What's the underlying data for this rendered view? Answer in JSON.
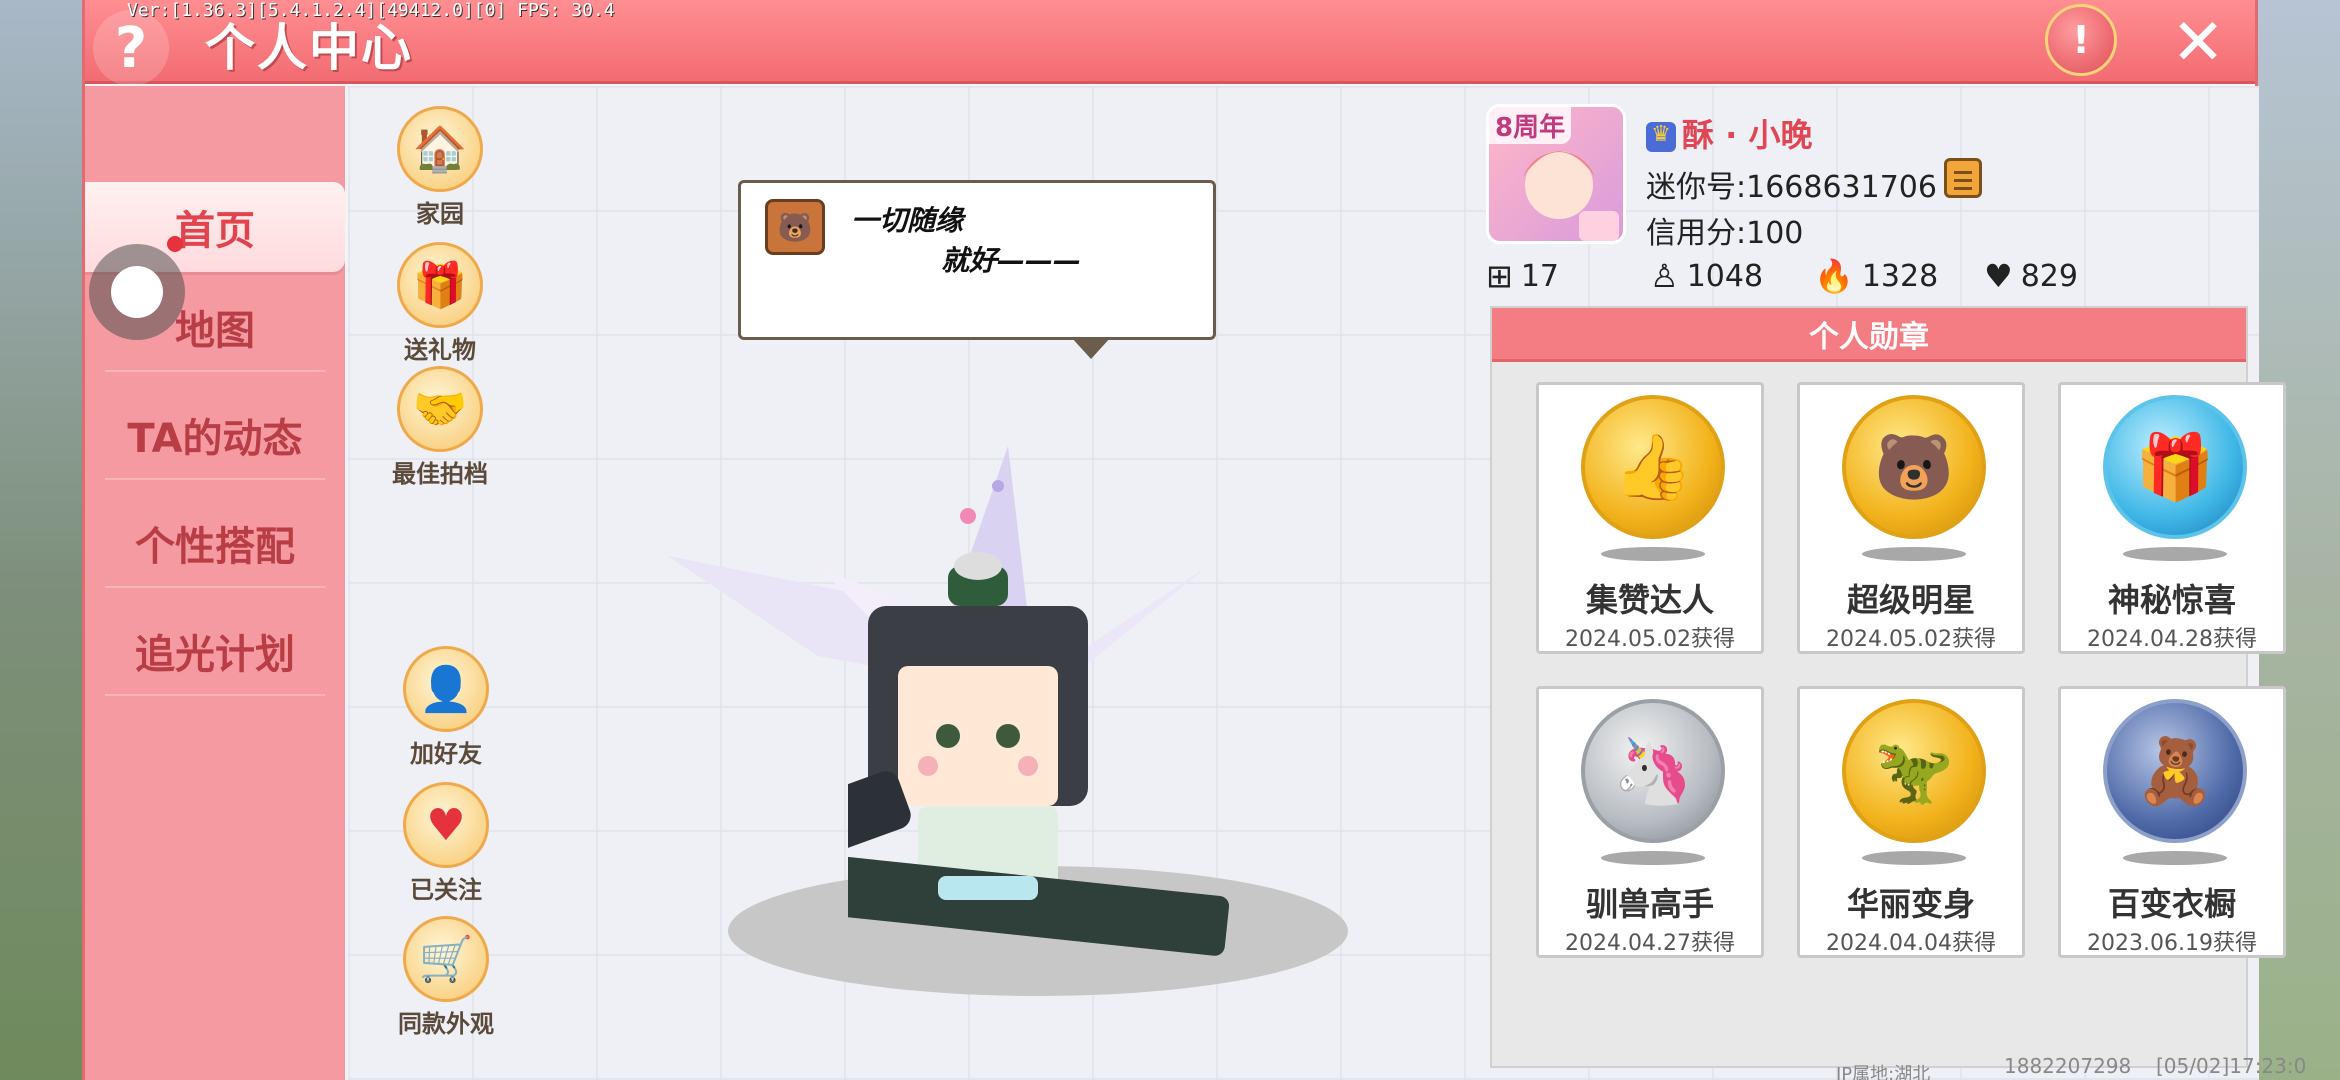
{
  "header": {
    "version": "Ver:[1.36.3][5.4.1.2.4][49412.0][0] FPS: 30.4",
    "title": "个人中心",
    "help_icon": "question-icon",
    "report_icon": "warning-icon",
    "close_icon": "close-icon"
  },
  "sidebar": {
    "items": [
      {
        "label": "首页",
        "active": true
      },
      {
        "label": "地图",
        "active": false
      },
      {
        "label": "TA的动态",
        "active": false
      },
      {
        "label": "个性搭配",
        "active": false
      },
      {
        "label": "追光计划",
        "active": false
      }
    ]
  },
  "actions_top": [
    {
      "label": "家园",
      "icon": "house-icon"
    },
    {
      "label": "送礼物",
      "icon": "gift-icon"
    },
    {
      "label": "最佳拍档",
      "icon": "handshake-icon"
    }
  ],
  "actions_bottom": [
    {
      "label": "加好友",
      "icon": "add-friend-icon"
    },
    {
      "label": "已关注",
      "icon": "heart-icon"
    },
    {
      "label": "同款外观",
      "icon": "cart-icon"
    }
  ],
  "speech": {
    "line1": "一切随缘",
    "line2": "就好———"
  },
  "profile": {
    "anniversary_badge": "8周年",
    "nickname": "酥 · 小晚",
    "mini_id": "迷你号:1668631706",
    "credit": "信用分:100"
  },
  "stats": [
    {
      "icon": "plus-flag-icon",
      "value": "17"
    },
    {
      "icon": "fans-icon",
      "value": "1048"
    },
    {
      "icon": "fire-icon",
      "value": "1328"
    },
    {
      "icon": "heart-stat-icon",
      "value": "829"
    }
  ],
  "medals": {
    "title": "个人勋章",
    "items": [
      {
        "name": "集赞达人",
        "date": "2024.05.02获得",
        "style": "gold",
        "icon": "thumbs-up-icon"
      },
      {
        "name": "超级明星",
        "date": "2024.05.02获得",
        "style": "gold",
        "icon": "star-bear-icon"
      },
      {
        "name": "神秘惊喜",
        "date": "2024.04.28获得",
        "style": "blue",
        "icon": "gift-box-icon"
      },
      {
        "name": "驯兽高手",
        "date": "2024.04.27获得",
        "style": "silver",
        "icon": "unicorn-icon"
      },
      {
        "name": "华丽变身",
        "date": "2024.04.04获得",
        "style": "gold",
        "icon": "dinosaur-icon"
      },
      {
        "name": "百变衣橱",
        "date": "2023.06.19获得",
        "style": "navy",
        "icon": "wardrobe-icon"
      }
    ]
  },
  "footer": {
    "ip": "IP属地:湖北",
    "uid": "1882207298",
    "time": "[05/02]17:23:0"
  }
}
